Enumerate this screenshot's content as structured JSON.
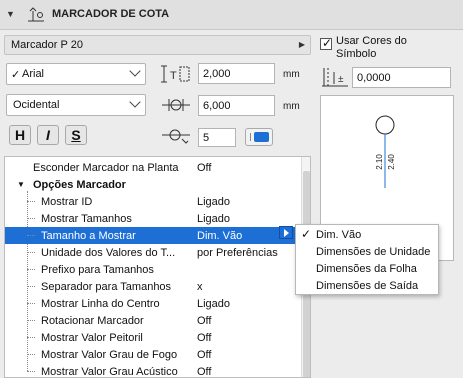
{
  "header": {
    "title": "MARCADOR DE COTA",
    "collapse_icon": "chevron-down-icon",
    "section_icon": "elevation-dimension-icon"
  },
  "marker_selector": {
    "label": "Marcador P 20"
  },
  "symbol_colors": {
    "label_line1": "Usar Cores do",
    "label_line2": "Símbolo",
    "checked": true
  },
  "font": {
    "name": "Arial",
    "checked": true
  },
  "encoding": {
    "value": "Ocidental"
  },
  "text_height": {
    "value": "2,000",
    "unit": "mm"
  },
  "text_offset": {
    "value": "6,000",
    "unit": "mm"
  },
  "text_pen": {
    "value": "5"
  },
  "marker_size": {
    "value": "0,0000"
  },
  "style_buttons": {
    "bold": "H",
    "italic": "I",
    "underline": "S"
  },
  "preview": {
    "text1": "2.10",
    "text2": "2.40"
  },
  "settings_tree": {
    "rows": [
      {
        "label": "Esconder Marcador na Planta",
        "value": "Off",
        "level": 0
      },
      {
        "label": "Opções Marcador",
        "value": "",
        "level": "group"
      },
      {
        "label": "Mostrar ID",
        "value": "Ligado",
        "level": 1
      },
      {
        "label": "Mostrar Tamanhos",
        "value": "Ligado",
        "level": 1
      },
      {
        "label": "Tamanho a Mostrar",
        "value": "Dim. Vão",
        "level": 1,
        "selected": true
      },
      {
        "label": "Unidade dos Valores do T...",
        "value": "por Preferências",
        "level": 1
      },
      {
        "label": "Prefixo para Tamanhos",
        "value": "",
        "level": 1
      },
      {
        "label": "Separador para Tamanhos",
        "value": "x",
        "level": 1
      },
      {
        "label": "Mostrar Linha do Centro",
        "value": "Ligado",
        "level": 1
      },
      {
        "label": "Rotacionar Marcador",
        "value": "Off",
        "level": 1
      },
      {
        "label": "Mostrar Valor Peitoril",
        "value": "Off",
        "level": 1
      },
      {
        "label": "Mostrar Valor Grau de Fogo",
        "value": "Off",
        "level": 1
      },
      {
        "label": "Mostrar Valor Grau Acústico",
        "value": "Off",
        "level": 1
      }
    ]
  },
  "dropdown_menu": {
    "items": [
      "Dim. Vão",
      "Dimensões de Unidade",
      "Dimensões da Folha",
      "Dimensões de Saída"
    ],
    "selected_index": 0
  },
  "colors": {
    "selection": "#1d6fd6",
    "accent_pen": "#1d6fd6"
  }
}
